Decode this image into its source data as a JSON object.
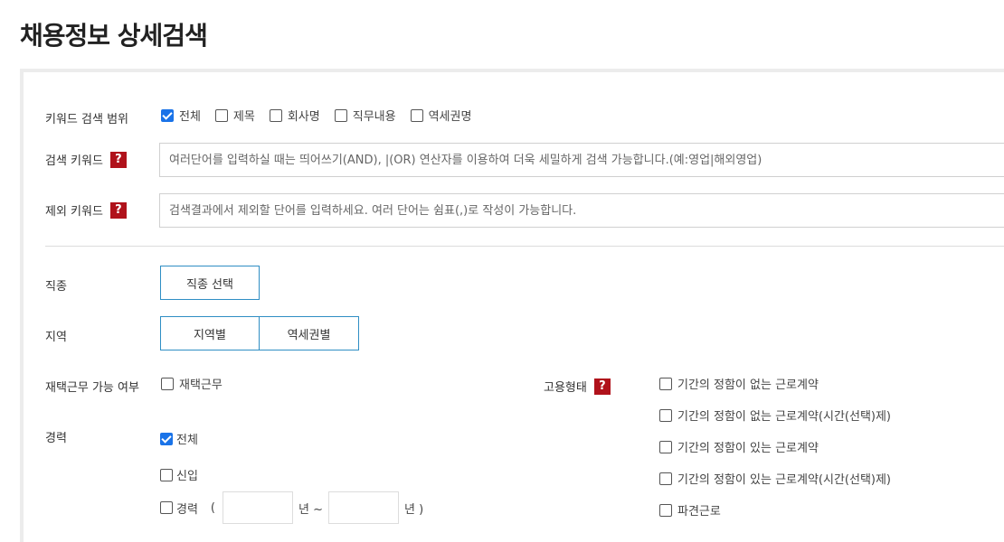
{
  "page": {
    "title": "채용정보 상세검색"
  },
  "keyword_scope": {
    "label": "키워드 검색 범위",
    "options": [
      {
        "label": "전체",
        "checked": true
      },
      {
        "label": "제목",
        "checked": false
      },
      {
        "label": "회사명",
        "checked": false
      },
      {
        "label": "직무내용",
        "checked": false
      },
      {
        "label": "역세권명",
        "checked": false
      }
    ]
  },
  "search_keyword": {
    "label": "검색 키워드",
    "help": "?",
    "placeholder": "여러단어를 입력하실 때는 띄어쓰기(AND), |(OR) 연산자를 이용하여 더욱 세밀하게 검색 가능합니다.(예:영업|해외영업)"
  },
  "exclude_keyword": {
    "label": "제외 키워드",
    "help": "?",
    "placeholder": "검색결과에서 제외할 단어를 입력하세요. 여러 단어는 쉼표(,)로 작성이 가능합니다."
  },
  "job_type": {
    "label": "직종",
    "button": "직종 선택"
  },
  "region": {
    "label": "지역",
    "by_region": "지역별",
    "by_station": "역세권별"
  },
  "remote": {
    "label": "재택근무 가능 여부",
    "option": "재택근무",
    "checked": false
  },
  "employment": {
    "label": "고용형태",
    "help": "?",
    "options": [
      "기간의 정함이 없는 근로계약",
      "기간의 정함이 없는 근로계약(시간(선택)제)",
      "기간의 정함이 있는 근로계약",
      "기간의 정함이 있는 근로계약(시간(선택)제)",
      "파견근로"
    ]
  },
  "career": {
    "label": "경력",
    "all": "전체",
    "all_checked": true,
    "newcomer": "신입",
    "experienced": "경력",
    "open_paren": "(",
    "year_from": "년 ~",
    "year_to": "년 )"
  },
  "colors": {
    "accent": "#1a73e8",
    "button_border": "#2f8ec4",
    "help_bg": "#b0121b"
  }
}
